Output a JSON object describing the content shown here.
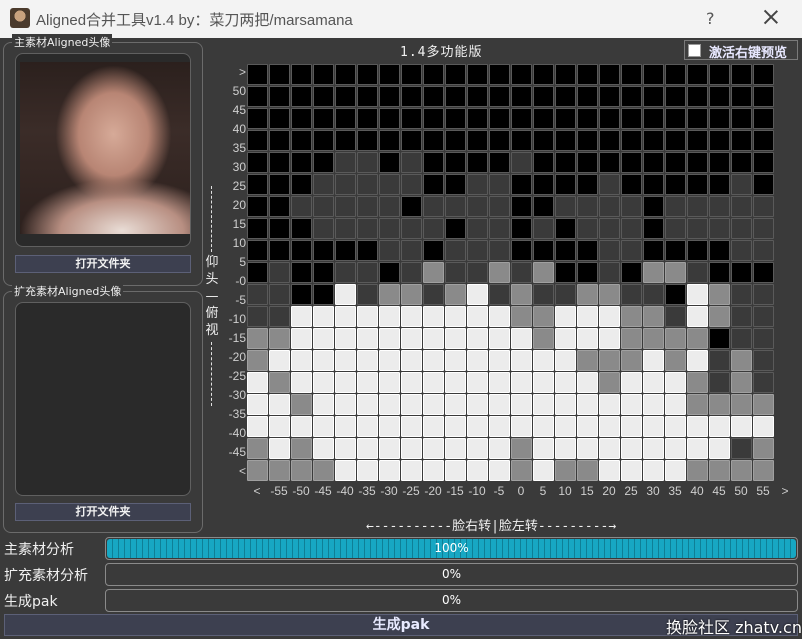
{
  "window": {
    "title": "Aligned合并工具v1.4  by：菜刀两把/marsamana",
    "help": "?",
    "app_icon": "app-face-icon",
    "close_icon": "close-icon"
  },
  "main_source": {
    "group_title": "主素材Aligned头像",
    "open_button": "打开文件夹"
  },
  "ext_source": {
    "group_title": "扩充素材Aligned头像",
    "open_button": "打开文件夹"
  },
  "header": {
    "version": "1.4多功能版",
    "right_click_label": "激活右键预览",
    "right_click_checked": false
  },
  "grid": {
    "y_labels": [
      ">",
      "50",
      "45",
      "40",
      "35",
      "30",
      "25",
      "20",
      "15",
      "10",
      "5",
      "-0",
      "-5",
      "-10",
      "-15",
      "-20",
      "-25",
      "-30",
      "-35",
      "-40",
      "-45",
      "<"
    ],
    "x_labels": [
      "<",
      "-55",
      "-50",
      "-45",
      "-40",
      "-35",
      "-30",
      "-25",
      "-20",
      "-15",
      "-10",
      "-5",
      "0",
      "5",
      "10",
      "15",
      "20",
      "25",
      "30",
      "35",
      "40",
      "45",
      "50",
      "55",
      ">"
    ],
    "vertical_axis_chars": [
      "仰",
      "头",
      "—",
      "俯",
      "视"
    ],
    "horizontal_axis_label": "←----------脸右转|脸左转---------→",
    "rows": [
      "000000000000000000000000",
      "000000000000000000000000",
      "000000000000000000000000",
      "000000000000000000000000",
      "000011010000100000000000",
      "000111110011000010000010",
      "001111101111001111011111",
      "000111111011010111011111",
      "000000110111000011000011",
      "010011012112120010221000",
      "110031221231211221103211",
      "113333333333223332213211",
      "223333333333323332222011",
      "233333333333333222323121",
      "323333333333333323332121",
      "332333333333333333332222",
      "333333333333333333333333",
      "232333333333233333333312",
      "222233333333232233332222"
    ]
  },
  "progress": [
    {
      "label": "主素材分析",
      "percent": 100,
      "text": "100%"
    },
    {
      "label": "扩充素材分析",
      "percent": 0,
      "text": "0%"
    },
    {
      "label": "生成pak",
      "percent": 0,
      "text": "0%"
    }
  ],
  "generate_button": "生成pak",
  "watermark": "换脸社区 zhatv.cn"
}
